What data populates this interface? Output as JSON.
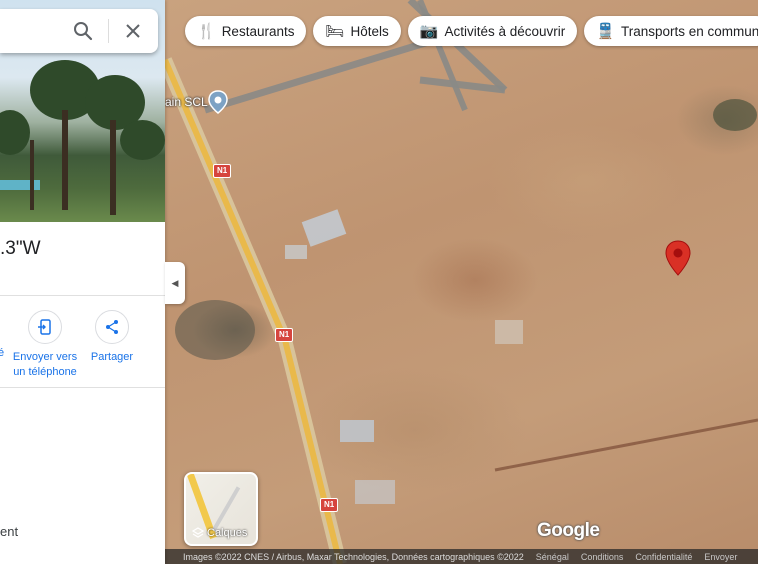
{
  "chips": [
    {
      "icon": "restaurant-icon",
      "glyph": "🍴",
      "label": "Restaurants"
    },
    {
      "icon": "bed-icon",
      "glyph": "🛏",
      "label": "Hôtels"
    },
    {
      "icon": "camera-icon",
      "glyph": "📷",
      "label": "Activités à découvrir"
    },
    {
      "icon": "train-icon",
      "glyph": "🚆",
      "label": "Transports en commun"
    }
  ],
  "map": {
    "poi_label": "ain SCL",
    "road_shields": [
      "N1",
      "N1",
      "N1"
    ],
    "layers_label": "Calques",
    "google_logo": "Google",
    "attribution": "Images ©2022 CNES / Airbus, Maxar Technologies, Données cartographiques ©2022",
    "footer_links": [
      "Sénégal",
      "Conditions",
      "Confidentialité",
      "Envoyer"
    ]
  },
  "panel": {
    "coordinates": ".3\"W",
    "actions": [
      {
        "label_line1": "é",
        "label_line2": ""
      },
      {
        "label_line1": "Envoyer vers",
        "label_line2": "un téléphone"
      },
      {
        "label_line1": "Partager",
        "label_line2": ""
      }
    ],
    "bottom_text": "ent"
  },
  "colors": {
    "accent": "#1a73e8",
    "pin": "#d93025"
  }
}
